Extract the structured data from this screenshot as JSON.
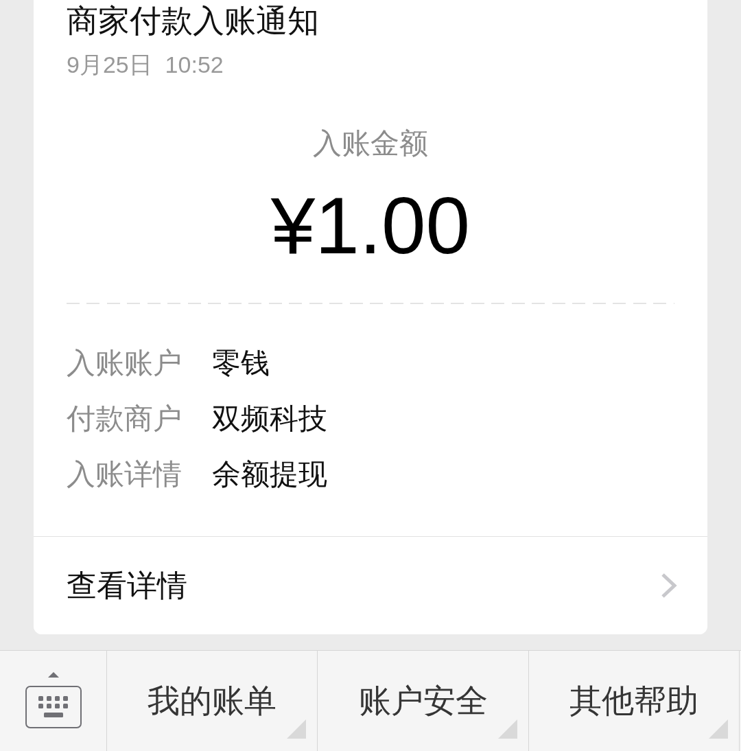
{
  "notice": {
    "title": "商家付款入账通知",
    "time": "9月25日  10:52"
  },
  "amount": {
    "label": "入账金额",
    "value": "¥1.00"
  },
  "details": [
    {
      "label": "入账账户",
      "value": "零钱"
    },
    {
      "label": "付款商户",
      "value": "双频科技"
    },
    {
      "label": "入账详情",
      "value": "余额提现"
    }
  ],
  "view_details": {
    "label": "查看详情"
  },
  "menu_bar": {
    "items": [
      {
        "label": "我的账单"
      },
      {
        "label": "账户安全"
      },
      {
        "label": "其他帮助"
      }
    ]
  }
}
